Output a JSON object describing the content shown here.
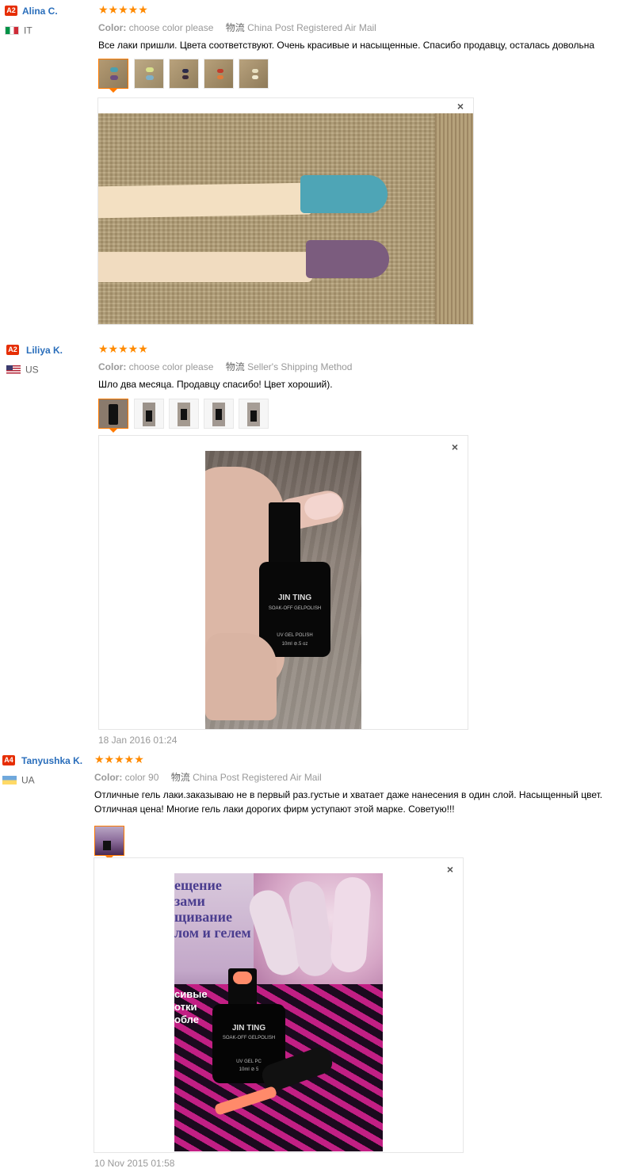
{
  "reviews": [
    {
      "level": "A2",
      "name": "Alina C.",
      "country": "IT",
      "flag_colors": [
        "#009246",
        "#ffffff",
        "#ce2b37"
      ],
      "stars": "★★★★★",
      "color_label": "Color:",
      "color_value": "choose color please",
      "ship_icon": "物流",
      "shipping": "China Post Registered Air Mail",
      "text": "Все лаки пришли. Цвета соответствуют. Очень красивые и насыщенные. Спасибо продавцу, осталась довольна",
      "close_icon": "×",
      "date": ""
    },
    {
      "level": "A2",
      "name": "Liliya K.",
      "country": "US",
      "flag_colors": [
        "#b22234",
        "#ffffff",
        "#3c3b6e"
      ],
      "stars": "★★★★★",
      "color_label": "Color:",
      "color_value": "choose color please",
      "ship_icon": "物流",
      "shipping": "Seller's Shipping Method",
      "text": "Шло два месяца. Продавцу спасибо! Цвет хороший).",
      "close_icon": "×",
      "date": "18 Jan 2016 01:24",
      "brand_logo": "JIN TING",
      "bottle_label_1": "SOAK-OFF GELPOLISH",
      "bottle_label_2": "UV GEL POLISH",
      "bottle_label_3": "10ml ⊘.5 oz"
    },
    {
      "level": "A4",
      "name": "Tanyushka K.",
      "country": "UA",
      "flag_colors": [
        "#0057b7",
        "#ffd700"
      ],
      "stars": "★★★★★",
      "color_label": "Color:",
      "color_value": "color 90",
      "ship_icon": "物流",
      "shipping": "China Post Registered Air Mail",
      "text_line1": "Отличные гель лаки.заказываю не в первый раз.густые и хватает даже нанесения в один слой. Насыщенный цвет.",
      "text_line2": "Отличная цена! Многие гель лаки дорогих фирм уступают этой марке. Советую!!!",
      "close_icon": "×",
      "date": "10 Nov 2015 01:58",
      "brand_logo": "JIN TING",
      "bottle_label_1": "SOAK-OFF GELPOLISH",
      "bottle_label_2": "UV GEL PC",
      "bottle_label_3": "10ml ⊘ 5",
      "poster_text": [
        "ещение",
        "зами",
        "щивание",
        "лом и гелем",
        "сивые",
        "отки",
        "обле"
      ]
    }
  ]
}
